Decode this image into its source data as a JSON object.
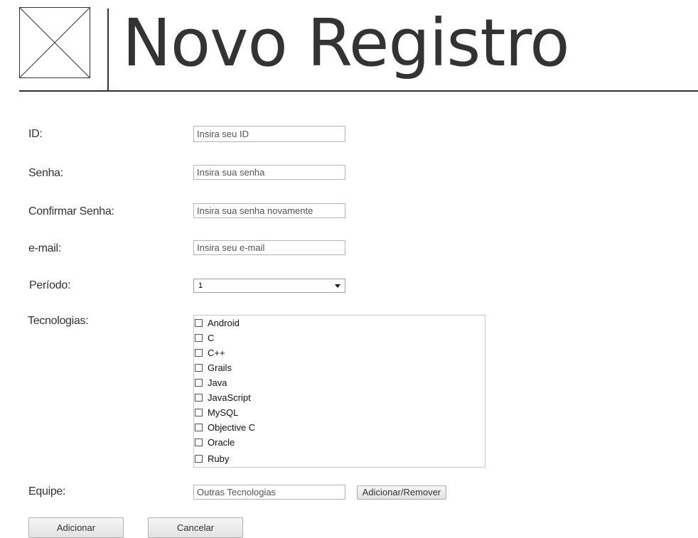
{
  "header": {
    "title": "Novo Registro",
    "logo_icon": "image-placeholder-icon"
  },
  "form": {
    "id": {
      "label": "ID:",
      "placeholder": "Insira seu ID",
      "value": ""
    },
    "senha": {
      "label": "Senha:",
      "placeholder": "Insira sua senha",
      "value": ""
    },
    "confirmar_senha": {
      "label": "Confirmar Senha:",
      "placeholder": "Insira sua senha novamente",
      "value": ""
    },
    "email": {
      "label": "e-mail:",
      "placeholder": "Insira seu e-mail",
      "value": ""
    },
    "periodo": {
      "label": "Período:",
      "selected": "1"
    },
    "tecnologias": {
      "label": "Tecnologias:",
      "items": [
        {
          "label": "Android",
          "checked": false
        },
        {
          "label": "C",
          "checked": false
        },
        {
          "label": "C++",
          "checked": false
        },
        {
          "label": "Grails",
          "checked": false
        },
        {
          "label": "Java",
          "checked": false
        },
        {
          "label": "JavaScript",
          "checked": false
        },
        {
          "label": "MySQL",
          "checked": false
        },
        {
          "label": "Objective C",
          "checked": false
        },
        {
          "label": "Oracle",
          "checked": false
        },
        {
          "label": "Ruby",
          "checked": false
        }
      ]
    },
    "equipe": {
      "label": "Equipe:",
      "placeholder": "Outras Tecnologias",
      "value": "",
      "button_label": "Adicionar/Remover"
    }
  },
  "actions": {
    "add_label": "Adicionar",
    "cancel_label": "Cancelar"
  },
  "colors": {
    "text": "#333333",
    "border": "#b4b4b4",
    "background": "#ffffff"
  }
}
